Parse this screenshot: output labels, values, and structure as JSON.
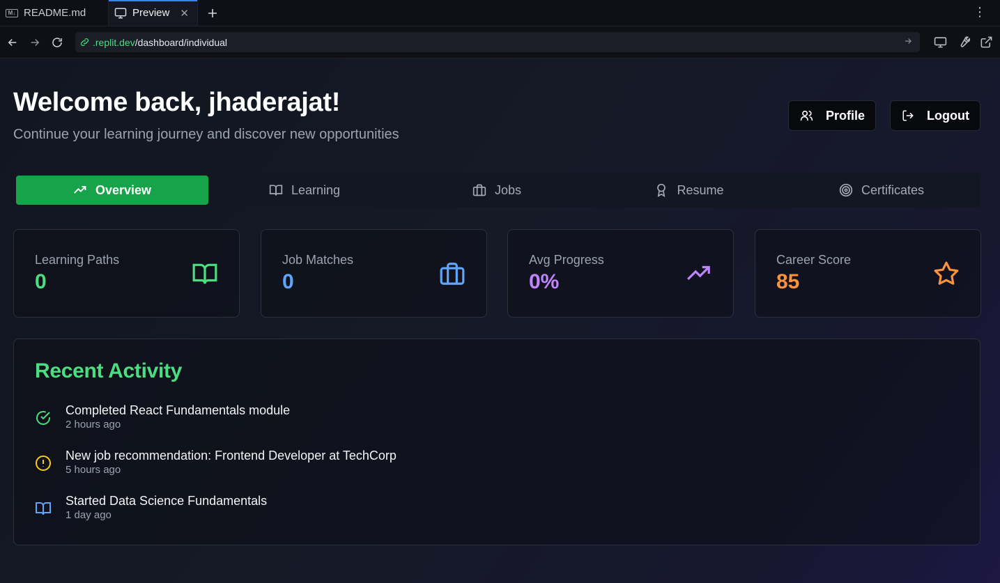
{
  "browser": {
    "tabs": [
      {
        "label": "README.md",
        "icon": "markdown-icon"
      },
      {
        "label": "Preview",
        "icon": "monitor-icon"
      }
    ],
    "url_domain": ".replit.dev",
    "url_path": "/dashboard/individual"
  },
  "header": {
    "title": "Welcome back, jhaderajat!",
    "subtitle": "Continue your learning journey and discover new opportunities",
    "profile_label": "Profile",
    "logout_label": "Logout"
  },
  "nav_tabs": [
    {
      "label": "Overview",
      "icon": "trending-up-icon",
      "active": true
    },
    {
      "label": "Learning",
      "icon": "book-icon",
      "active": false
    },
    {
      "label": "Jobs",
      "icon": "briefcase-icon",
      "active": false
    },
    {
      "label": "Resume",
      "icon": "award-icon",
      "active": false
    },
    {
      "label": "Certificates",
      "icon": "target-icon",
      "active": false
    }
  ],
  "stats": [
    {
      "label": "Learning Paths",
      "value": "0",
      "color": "#4ade80",
      "icon": "book-icon"
    },
    {
      "label": "Job Matches",
      "value": "0",
      "color": "#60a5fa",
      "icon": "briefcase-icon"
    },
    {
      "label": "Avg Progress",
      "value": "0%",
      "color": "#c084fc",
      "icon": "trending-up-icon"
    },
    {
      "label": "Career Score",
      "value": "85",
      "color": "#fb923c",
      "icon": "star-icon"
    }
  ],
  "activity": {
    "title": "Recent Activity",
    "items": [
      {
        "text": "Completed React Fundamentals module",
        "time": "2 hours ago",
        "icon": "check-circle-icon",
        "color": "#4ade80"
      },
      {
        "text": "New job recommendation: Frontend Developer at TechCorp",
        "time": "5 hours ago",
        "icon": "alert-circle-icon",
        "color": "#facc15"
      },
      {
        "text": "Started Data Science Fundamentals",
        "time": "1 day ago",
        "icon": "book-icon",
        "color": "#60a5fa"
      }
    ]
  }
}
